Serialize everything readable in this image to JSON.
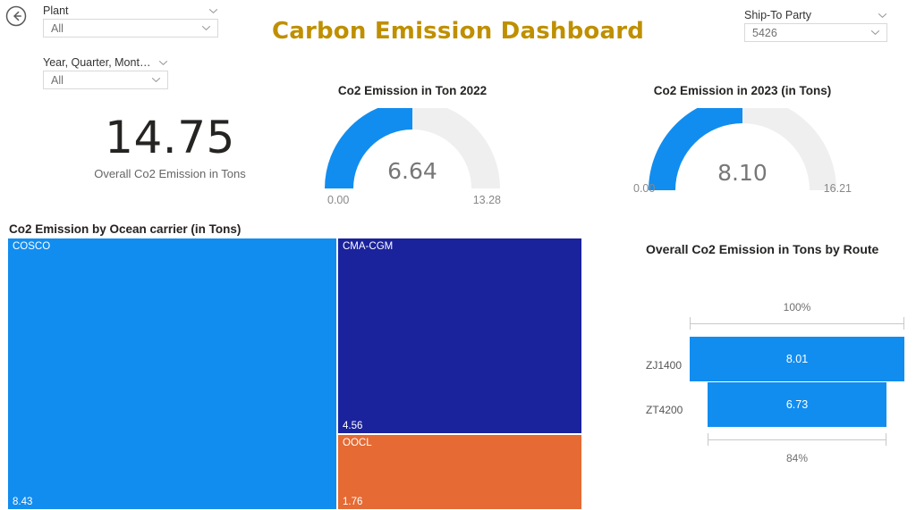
{
  "header": {
    "title": "Carbon Emission Dashboard",
    "title_color": "#BF8F00",
    "back_icon": "back-arrow-circle-icon"
  },
  "slicers": [
    {
      "id": "plant",
      "label": "Plant",
      "value": "All",
      "header_icon": "chevron-down-icon",
      "dropdown_icon": "chevron-down-icon"
    },
    {
      "id": "date",
      "label": "Year, Quarter, Month,...",
      "value": "All",
      "header_icon": "chevron-down-icon",
      "dropdown_icon": "chevron-down-icon"
    },
    {
      "id": "ship-to-party",
      "label": "Ship-To Party",
      "value": "5426",
      "header_icon": "chevron-down-icon",
      "dropdown_icon": "chevron-down-icon"
    }
  ],
  "kpi": {
    "value": "14.75",
    "label": "Overall Co2 Emission in Tons"
  },
  "chart_data": [
    {
      "type": "gauge",
      "id": "gauge-2022",
      "title": "Co2 Emission in Ton 2022",
      "value": 6.64,
      "value_label": "6.64",
      "min": 0.0,
      "min_label": "0.00",
      "max": 13.28,
      "max_label": "13.28",
      "fill_fraction": 0.5,
      "fill_color": "#118DF0",
      "track_color": "#EFEFEF"
    },
    {
      "type": "gauge",
      "id": "gauge-2023",
      "title": "Co2 Emission in 2023 (in Tons)",
      "value": 8.1,
      "value_label": "8.10",
      "min": 0.0,
      "min_label": "0.00",
      "max": 16.21,
      "max_label": "16.21",
      "fill_fraction": 0.4997,
      "fill_color": "#118DF0",
      "track_color": "#EFEFEF"
    },
    {
      "type": "treemap",
      "id": "treemap-ocean-carrier",
      "title": "Co2 Emission by Ocean carrier (in Tons)",
      "ylabel": "",
      "xlabel": "",
      "categories": [
        "COSCO",
        "CMA-CGM",
        "OOCL"
      ],
      "values": [
        8.43,
        4.56,
        1.76
      ],
      "value_labels": [
        "8.43",
        "4.56",
        "1.76"
      ],
      "colors": [
        "#118DF0",
        "#1A229C",
        "#E56A33"
      ]
    },
    {
      "type": "bar",
      "id": "funnel-route",
      "title": "Overall Co2 Emission in Tons by Route",
      "xlabel": "",
      "ylabel": "",
      "categories": [
        "ZJ1400",
        "ZT4200"
      ],
      "values": [
        8.01,
        6.73
      ],
      "value_labels": [
        "8.01",
        "6.73"
      ],
      "percent_labels": [
        "100%",
        "84%"
      ],
      "bar_color": "#118DF0",
      "legend": "none",
      "grid": false
    }
  ]
}
